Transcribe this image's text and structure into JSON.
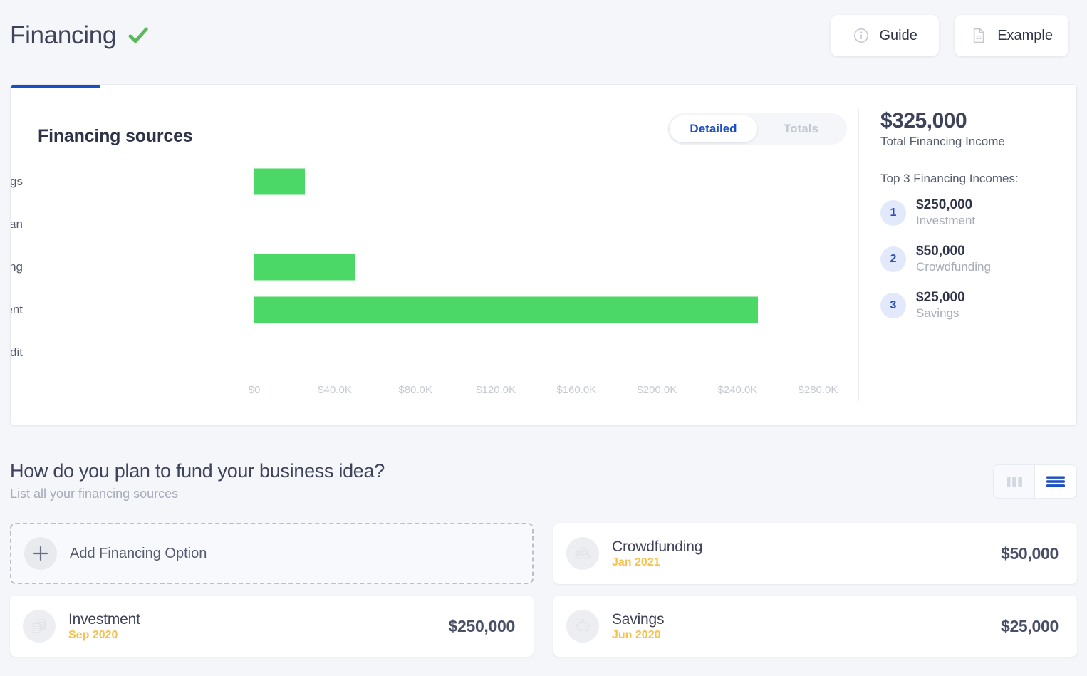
{
  "header": {
    "title": "Financing",
    "status_icon": "green-check-icon",
    "buttons": [
      {
        "label": "Guide",
        "icon": "info-circle-icon"
      },
      {
        "label": "Example",
        "icon": "document-icon"
      }
    ]
  },
  "chart_card": {
    "title": "Financing sources",
    "toggle": {
      "options": [
        "Detailed",
        "Totals"
      ],
      "selected": "Detailed"
    },
    "summary": {
      "total_amount": "$325,000",
      "total_label": "Total Financing Income",
      "top3_label": "Top 3 Financing Incomes:",
      "top3": [
        {
          "rank": "1",
          "amount": "$250,000",
          "name": "Investment"
        },
        {
          "rank": "2",
          "amount": "$50,000",
          "name": "Crowdfunding"
        },
        {
          "rank": "3",
          "amount": "$25,000",
          "name": "Savings"
        }
      ]
    }
  },
  "chart_data": {
    "type": "bar",
    "orientation": "horizontal",
    "title": "Financing sources",
    "xlabel": "",
    "ylabel": "",
    "categories": [
      "Savings",
      "Loan",
      "Crowdfunding",
      "Investment",
      "Line of Credit"
    ],
    "values": [
      25000,
      0,
      50000,
      250000,
      0
    ],
    "tick_labels": [
      "$0",
      "$40.0K",
      "$80.0K",
      "$120.0K",
      "$160.0K",
      "$200.0K",
      "$240.0K",
      "$280.0K"
    ],
    "tick_values": [
      0,
      40000,
      80000,
      120000,
      160000,
      200000,
      240000,
      280000
    ],
    "xlim": [
      0,
      300000
    ],
    "grid": false,
    "legend": "none",
    "bar_color": "#4bd867"
  },
  "section": {
    "title": "How do you plan to fund your business idea?",
    "subtitle": "List all your financing sources",
    "view_toggle": {
      "options": [
        {
          "icon": "grid-columns-icon",
          "active": false
        },
        {
          "icon": "list-rows-icon",
          "active": true
        }
      ]
    }
  },
  "add_card": {
    "label": "Add Financing Option",
    "icon": "plus-icon"
  },
  "cards": [
    {
      "name": "Investment",
      "date": "Sep 2020",
      "amount": "$250,000",
      "icon": "coins-stack-icon"
    },
    {
      "name": "Crowdfunding",
      "date": "Jan 2021",
      "amount": "$50,000",
      "icon": "people-group-icon"
    },
    {
      "name": "Savings",
      "date": "Jun 2020",
      "amount": "$25,000",
      "icon": "piggy-bank-icon"
    }
  ],
  "colors": {
    "accent_blue": "#1a4fc4",
    "bar_green": "#4bd867",
    "check_green": "#5cb85c",
    "date_yellow": "#f7c14b",
    "page_bg": "#f4f6f9"
  }
}
